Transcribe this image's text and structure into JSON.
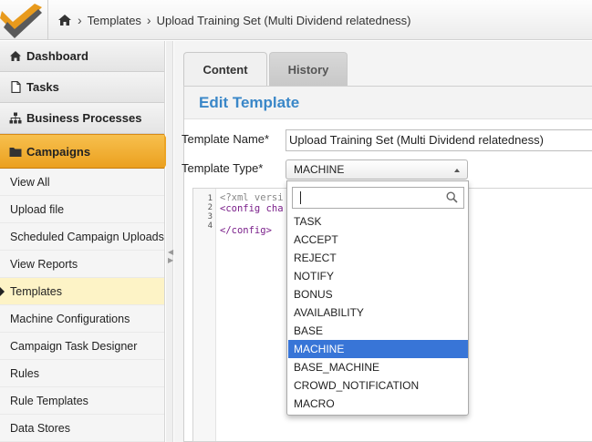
{
  "header": {
    "breadcrumbs": [
      "Templates",
      "Upload Training Set (Multi Dividend relatedness)"
    ]
  },
  "sidebar": {
    "main_items": [
      {
        "label": "Dashboard",
        "icon": "home-icon"
      },
      {
        "label": "Tasks",
        "icon": "document-icon"
      },
      {
        "label": "Business Processes",
        "icon": "sitemap-icon"
      }
    ],
    "active_item": {
      "label": "Campaigns",
      "icon": "folder-icon"
    },
    "sub_items": [
      "View All",
      "Upload file",
      "Scheduled Campaign Uploads",
      "View Reports",
      "Templates",
      "Machine Configurations",
      "Campaign Task Designer",
      "Rules",
      "Rule Templates",
      "Data Stores"
    ],
    "current_sub_item": "Templates"
  },
  "tabs": [
    "Content",
    "History"
  ],
  "active_tab": "Content",
  "form": {
    "heading": "Edit Template",
    "name_label": "Template Name*",
    "name_value": "Upload Training Set (Multi Dividend relatedness)",
    "type_label": "Template Type*",
    "type_value": "MACHINE"
  },
  "editor": {
    "line_numbers": [
      "1",
      "2",
      "3",
      "4"
    ],
    "lines": [
      "<?xml versi",
      "<config cha",
      "",
      "</config>"
    ]
  },
  "dropdown": {
    "search_value": "",
    "options": [
      "TASK",
      "ACCEPT",
      "REJECT",
      "NOTIFY",
      "BONUS",
      "AVAILABILITY",
      "BASE",
      "MACHINE",
      "BASE_MACHINE",
      "CROWD_NOTIFICATION",
      "MACRO"
    ],
    "selected": "MACHINE"
  },
  "colors": {
    "accent": "#3a87c8",
    "active_nav": "#eca424",
    "selected_option": "#3875d7"
  }
}
